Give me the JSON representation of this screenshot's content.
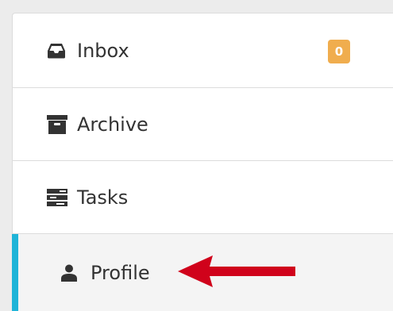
{
  "nav": {
    "items": [
      {
        "label": "Inbox",
        "icon": "inbox-icon",
        "badge": "0"
      },
      {
        "label": "Archive",
        "icon": "archive-icon"
      },
      {
        "label": "Tasks",
        "icon": "tasks-icon"
      },
      {
        "label": "Profile",
        "icon": "user-icon",
        "active": true
      }
    ]
  },
  "colors": {
    "badge": "#f0ad4e",
    "active_indicator": "#1fb4d8",
    "active_background": "#f4f4f4",
    "text": "#333333",
    "annotation_arrow": "#d0021b"
  },
  "annotation": {
    "icon": "red-arrow-icon",
    "points_to": "Profile"
  }
}
